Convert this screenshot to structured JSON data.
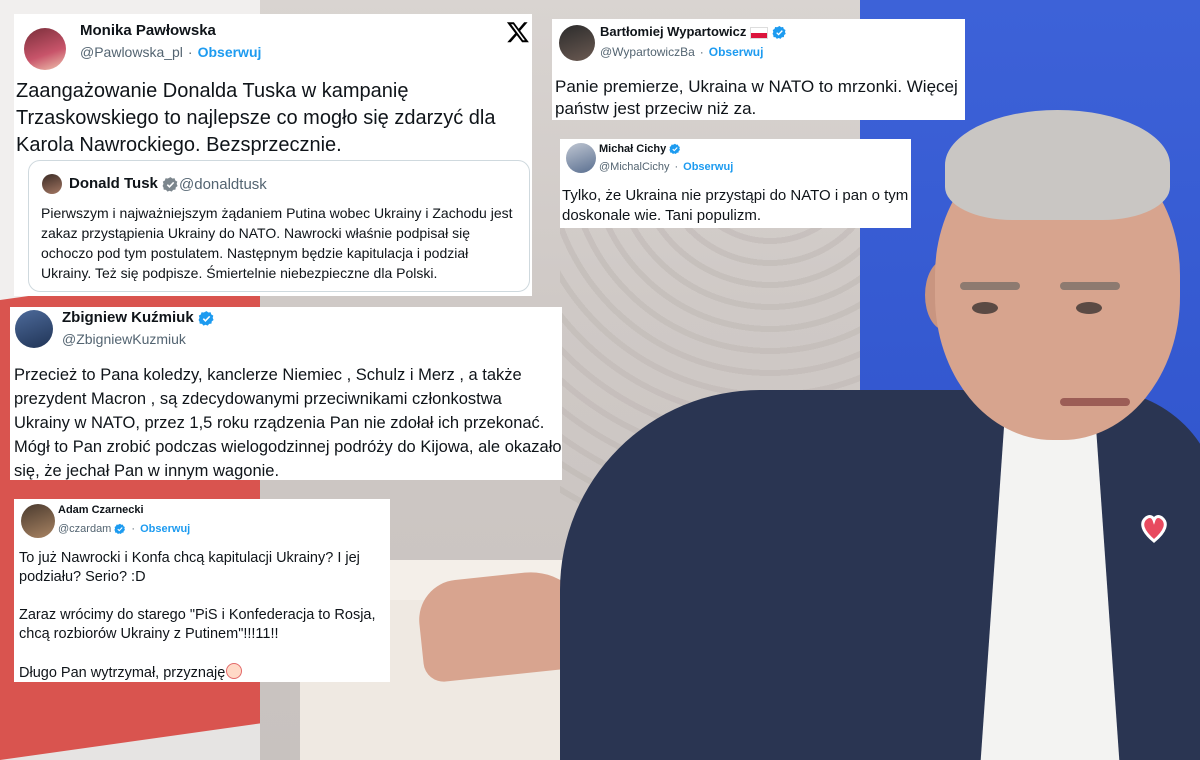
{
  "cards": {
    "pawlowska": {
      "name": "Monika Pawłowska",
      "handle": "@Pawlowska_pl",
      "follow": "Obserwuj",
      "text": "Zaangażowanie Donalda Tuska w kampanię Trzaskowskiego to najlepsze co mogło się zdarzyć dla Karola Nawrockiego. Bezsprzecznie.",
      "quote": {
        "name": "Donald Tusk",
        "handle": "@donaldtusk",
        "text": "Pierwszym i najważniejszym żądaniem Putina wobec Ukrainy i Zachodu jest zakaz przystąpienia Ukrainy do NATO. Nawrocki właśnie podpisał się ochoczo pod tym postulatem. Następnym będzie kapitulacja i podział Ukrainy. Też się podpisze. Śmiertelnie niebezpieczne dla Polski."
      }
    },
    "wypartowicz": {
      "name": "Bartłomiej Wypartowicz",
      "handle": "@WypartowiczBa",
      "follow": "Obserwuj",
      "text": "Panie premierze, Ukraina w NATO to mrzonki. Więcej państw jest przeciw niż za."
    },
    "cichy": {
      "name": "Michał Cichy",
      "handle": "@MichalCichy",
      "follow": "Obserwuj",
      "text": "Tylko, że Ukraina nie przystąpi do NATO i pan o tym doskonale wie. Tani populizm."
    },
    "kuzmiuk": {
      "name": "Zbigniew Kuźmiuk",
      "handle": "@ZbigniewKuzmiuk",
      "text": "Przecież to Pana koledzy, kanclerze Niemiec , Schulz i Merz , a także prezydent Macron , są zdecydowanymi przeciwnikami członkostwa Ukrainy w NATO, przez 1,5 roku rządzenia Pan nie zdołał ich przekonać. Mógł to Pan zrobić podczas wielogodzinnej podróży do Kijowa, ale okazało się, że jechał Pan w innym wagonie."
    },
    "czarnecki": {
      "name": "Adam Czarnecki",
      "handle": "@czardam",
      "follow": "Obserwuj",
      "text": "To już Nawrocki i Konfa chcą kapitulacji Ukrainy? I jej podziału? Serio? :D\n\nZaraz wrócimy do starego \"PiS i Konfederacja to Rosja, chcą rozbiorów Ukrainy z Putinem\"!!!11!!\n\nDługo Pan wytrzymał, przyznaję"
    }
  },
  "colors": {
    "link": "#1d9bf0",
    "verified": "#1d9bf0",
    "muted": "#536471",
    "text": "#0f1419"
  },
  "icons": [
    "x-logo-icon",
    "verified-badge-icon",
    "poland-flag-icon",
    "clown-emoji-icon"
  ]
}
